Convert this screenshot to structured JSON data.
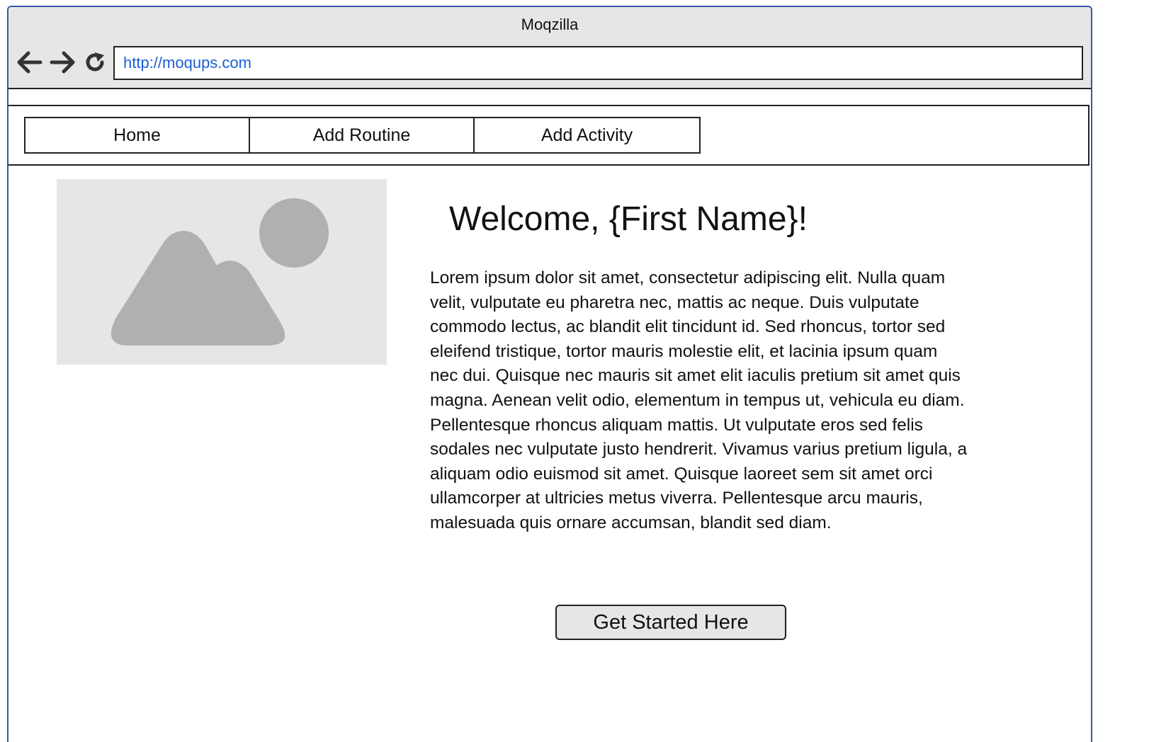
{
  "browser": {
    "title": "Moqzilla",
    "url": "http://moqups.com",
    "controls": {
      "back_icon": "arrow-left",
      "forward_icon": "arrow-right",
      "reload_icon": "reload"
    }
  },
  "navbar": {
    "items": [
      {
        "label": "Home"
      },
      {
        "label": "Add Routine"
      },
      {
        "label": "Add Activity"
      }
    ]
  },
  "main": {
    "image_icon": "image-placeholder",
    "welcome": "Welcome, {First Name}!",
    "body": "Lorem ipsum dolor sit amet, consectetur adipiscing elit. Nulla quam velit, vulputate eu pharetra nec, mattis ac neque. Duis vulputate commodo lectus, ac blandit elit tincidunt id. Sed rhoncus, tortor sed eleifend tristique, tortor mauris molestie elit, et lacinia ipsum quam nec dui. Quisque nec mauris sit amet elit iaculis pretium sit amet quis magna. Aenean velit odio, elementum in tempus ut, vehicula eu diam. Pellentesque rhoncus aliquam mattis. Ut vulputate eros sed felis sodales nec vulputate justo hendrerit. Vivamus varius pretium ligula, a aliquam odio euismod sit amet. Quisque laoreet sem sit amet orci ullamcorper at ultricies metus viverra. Pellentesque arcu mauris, malesuada quis ornare accumsan, blandit sed diam.",
    "cta_label": "Get Started Here"
  },
  "colors": {
    "window_border": "#3a56a8",
    "chrome_bg": "#e6e6e6",
    "url_text": "#1a5fd6",
    "placeholder_shape": "#b0b0b0"
  }
}
